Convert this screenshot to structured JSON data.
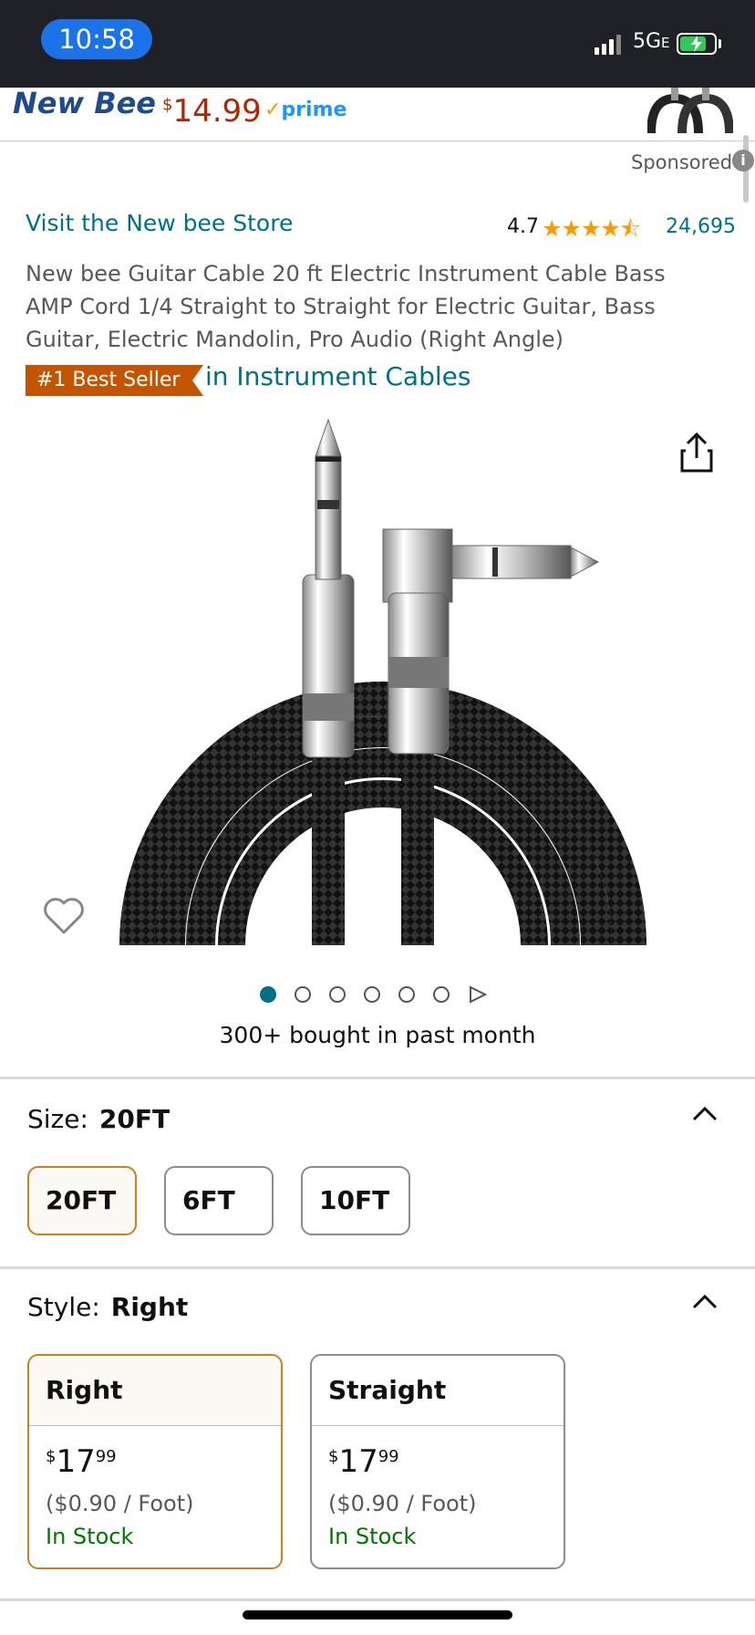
{
  "status_bar": {
    "time": "10:58",
    "network": "5G",
    "network_suffix": "E"
  },
  "ad_banner": {
    "brand": "New Bee",
    "price_symbol": "$",
    "price": "14.99",
    "prime": "prime"
  },
  "sponsored": {
    "label": "Sponsored",
    "info": "i"
  },
  "store_link": "Visit the New bee Store",
  "rating": {
    "value": "4.7",
    "stars": "★★★★⯪",
    "count": "24,695"
  },
  "product_title": "New bee Guitar Cable 20 ft Electric Instrument Cable Bass AMP Cord 1/4 Straight to Straight for Electric Guitar, Bass Guitar, Electric Mandolin, Pro Audio (Right Angle)",
  "badge": {
    "label": "#1 Best Seller",
    "category": "in Instrument Cables"
  },
  "gallery": {
    "image_count": 6,
    "current": 1
  },
  "bought": "300+ bought in past month",
  "size": {
    "label": "Size:",
    "selected": "20FT",
    "options": [
      "20FT",
      "6FT",
      "10FT"
    ]
  },
  "style": {
    "label": "Style:",
    "selected": "Right",
    "options": [
      {
        "name": "Right",
        "currency": "$",
        "whole": "17",
        "cents": "99",
        "per_unit": "($0.90 / Foot)",
        "stock": "In Stock"
      },
      {
        "name": "Straight",
        "currency": "$",
        "whole": "17",
        "cents": "99",
        "per_unit": "($0.90 / Foot)",
        "stock": "In Stock"
      }
    ]
  },
  "colors": {
    "link": "#007185",
    "price": "#b12704",
    "stock": "#007600",
    "badge": "#c45500",
    "selected_border": "#c7821f"
  }
}
